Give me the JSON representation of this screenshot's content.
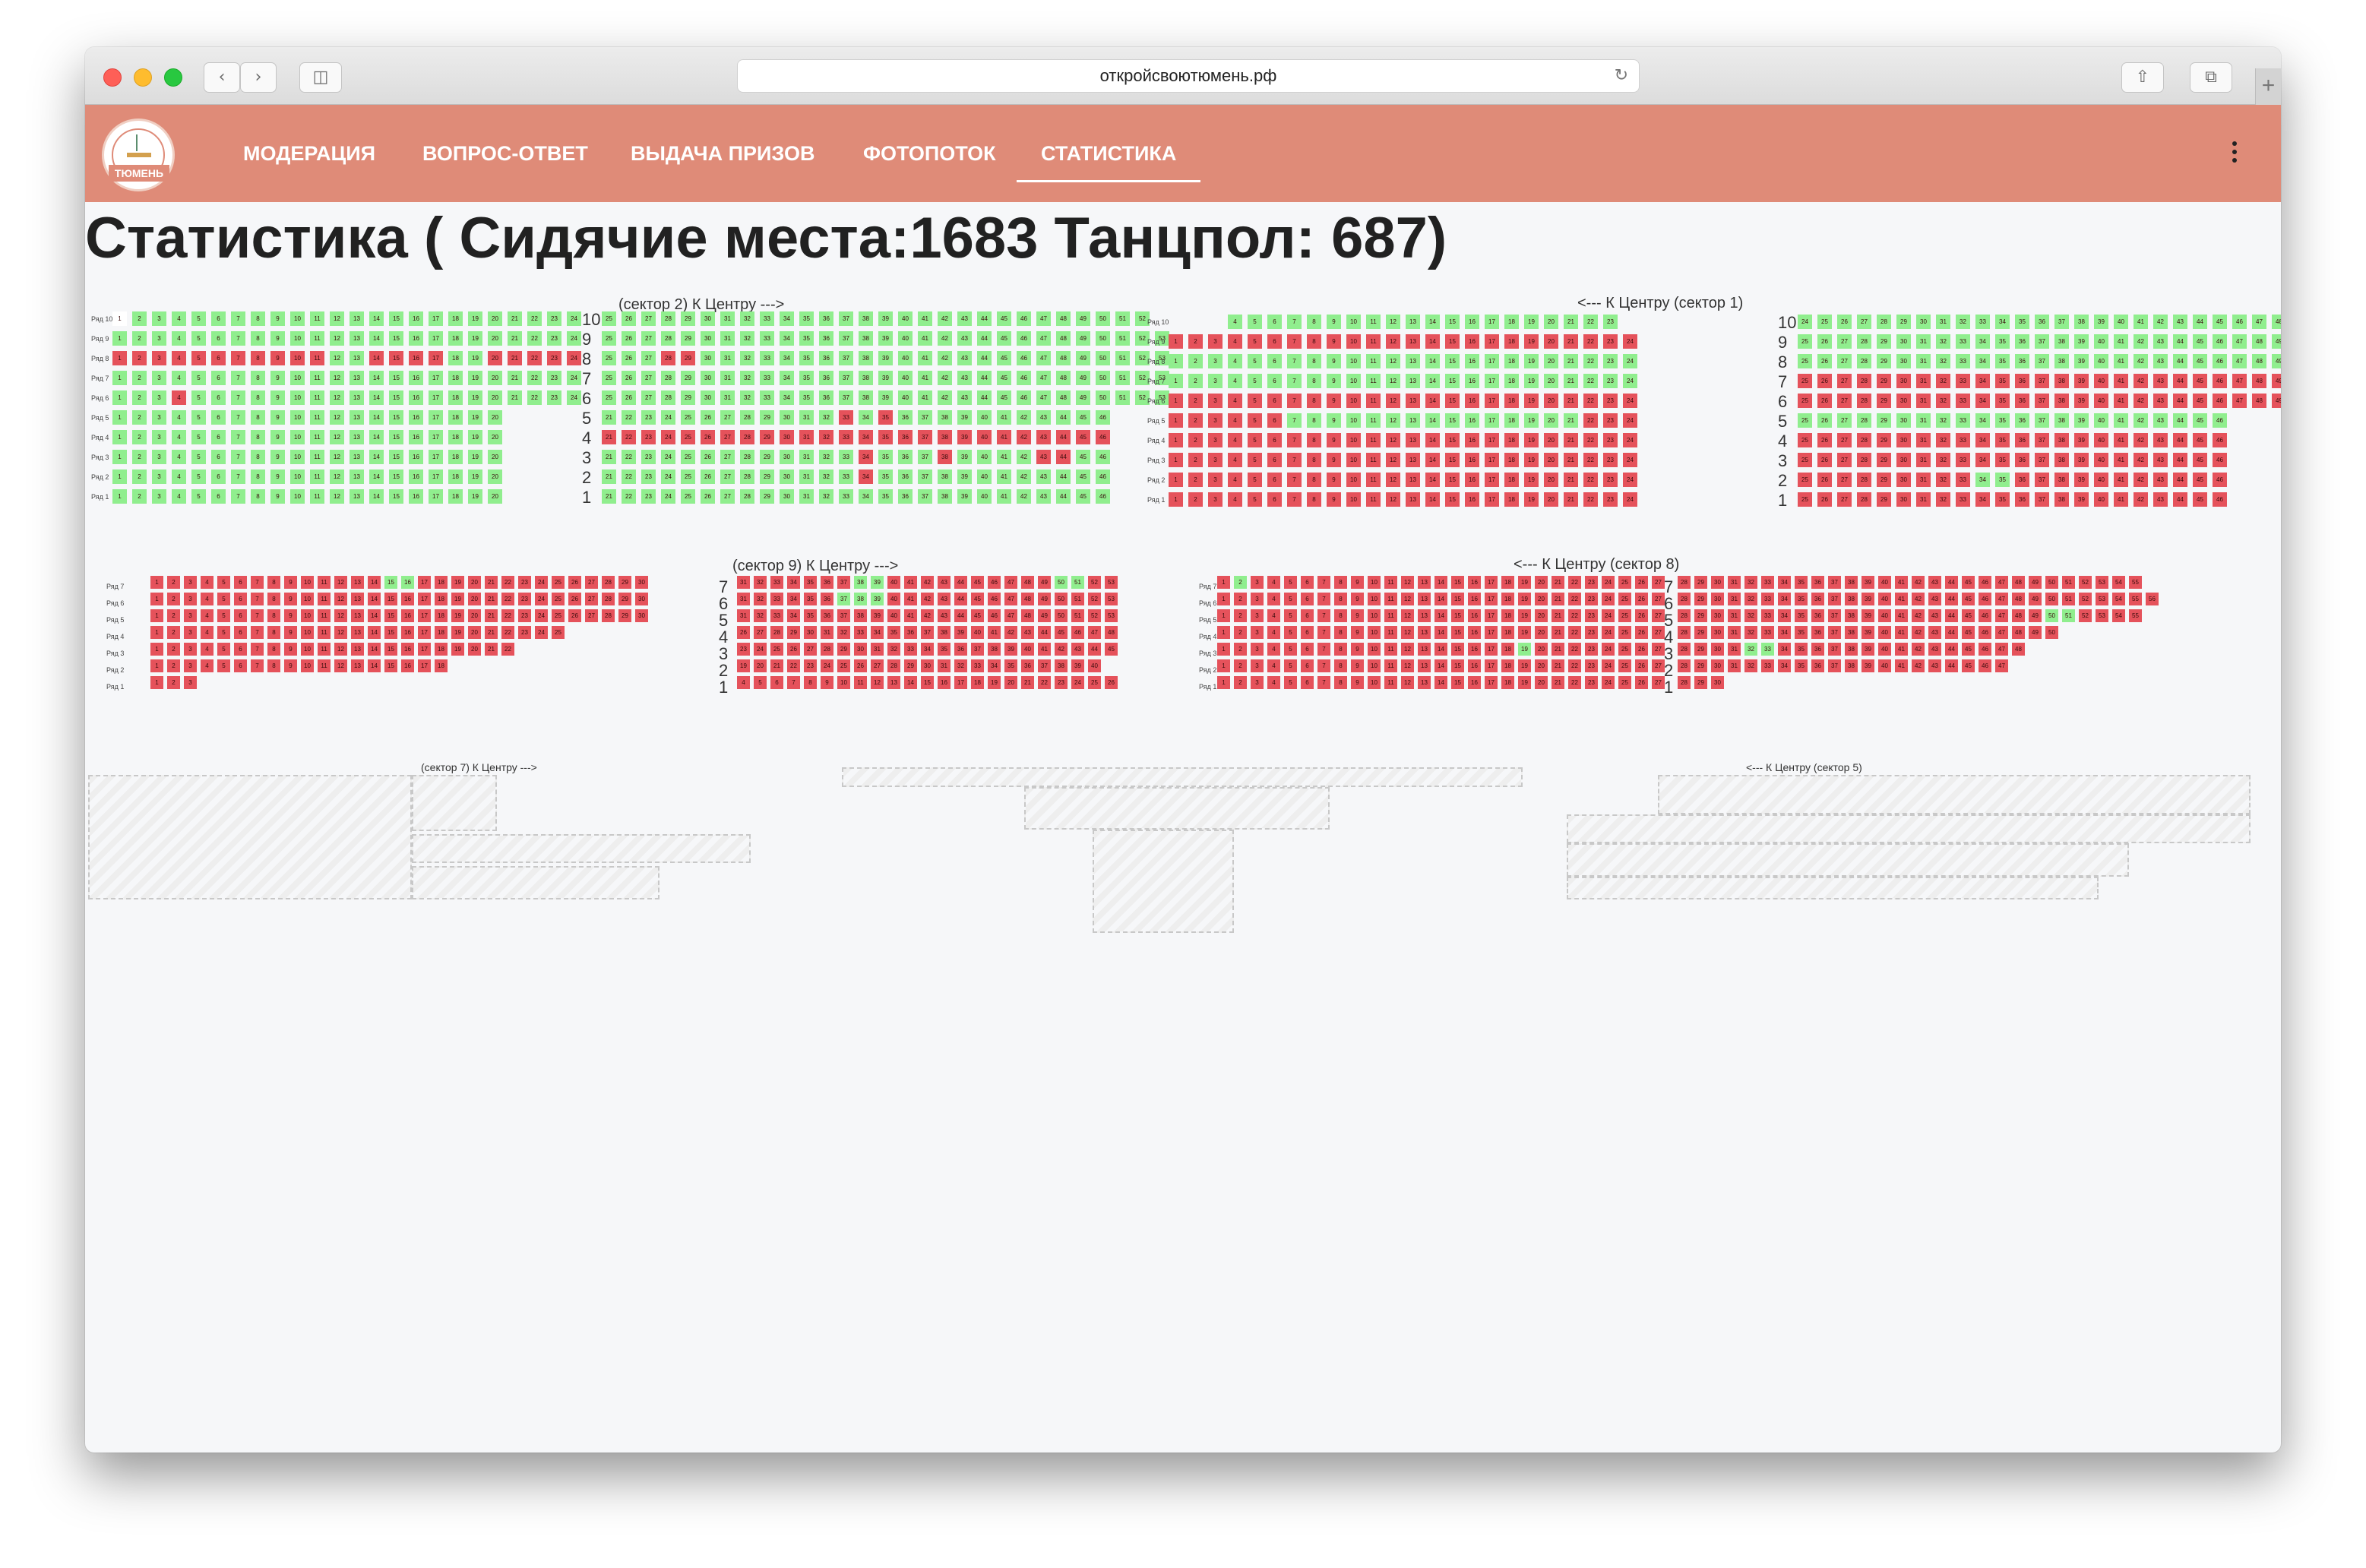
{
  "browser": {
    "url": "откройсвоютюмень.рф",
    "back_icon": "chevron-left-icon",
    "forward_icon": "chevron-right-icon",
    "sidebar_icon": "sidebar-icon",
    "reload_icon": "reload-icon",
    "share_icon": "share-icon",
    "tabs_icon": "tabs-icon",
    "new_tab_label": "+"
  },
  "header": {
    "logo_text": "ТЮМЕНЬ",
    "nav": [
      {
        "label": "МОДЕРАЦИЯ",
        "active": false
      },
      {
        "label": "ВОПРОС-ОТВЕТ",
        "active": false
      },
      {
        "label": "ВЫДАЧА ПРИЗОВ",
        "active": false
      },
      {
        "label": "ФОТОПОТОК",
        "active": false
      },
      {
        "label": "СТАТИСТИКА",
        "active": true
      }
    ],
    "menu_icon": "more-vertical-icon",
    "background": "#df8b78"
  },
  "page": {
    "title": "Статистика ( Сидячие места:1683 Танцпол: 687)"
  },
  "legend_colors": {
    "free": "#90ee8e",
    "taken": "#e5525b",
    "unmarked": "#ffffff"
  },
  "sectors": [
    {
      "id": "sector-2",
      "title": "(сектор 2) К Центру --->",
      "rows": [
        {
          "label": "Ряд 10",
          "number": 10,
          "blocks": [
            {
              "seats": "1w 2-23g 24-24g"
            },
            {
              "seats": "25-52g"
            }
          ]
        },
        {
          "label": "Ряд 9",
          "number": 9,
          "blocks": [
            {
              "seats": "1-24g"
            },
            {
              "seats": "25-53g"
            }
          ]
        },
        {
          "label": "Ряд 8",
          "number": 8,
          "blocks": [
            {
              "seats": "1-11r 12-13g 14-17r 18-19g 20-24r"
            },
            {
              "seats": "25-27g 28-29r 30-33g 34-53g"
            }
          ]
        },
        {
          "label": "Ряд 7",
          "number": 7,
          "blocks": [
            {
              "seats": "1-24g"
            },
            {
              "seats": "25-53g"
            }
          ]
        },
        {
          "label": "Ряд 6",
          "number": 6,
          "blocks": [
            {
              "seats": "1-3g 4r 5-24g"
            },
            {
              "seats": "25-53g"
            }
          ]
        },
        {
          "label": "Ряд 5",
          "number": 5,
          "blocks": [
            {
              "seats": "1-20g"
            },
            {
              "seats": "21-32g 33r 34g 35r 36-46g"
            }
          ]
        },
        {
          "label": "Ряд 4",
          "number": 4,
          "blocks": [
            {
              "seats": "1-20g"
            },
            {
              "seats": "21-46r"
            }
          ]
        },
        {
          "label": "Ряд 3",
          "number": 3,
          "blocks": [
            {
              "seats": "1-20g"
            },
            {
              "seats": "21-33g 34r 35-37g 38r 39-42g 43-44r 45-46g"
            }
          ]
        },
        {
          "label": "Ряд 2",
          "number": 2,
          "blocks": [
            {
              "seats": "1-20g"
            },
            {
              "seats": "21-33g 34r 35-46g"
            }
          ]
        },
        {
          "label": "Ряд 1",
          "number": 1,
          "blocks": [
            {
              "seats": "1-20g"
            },
            {
              "seats": "21-46g"
            }
          ]
        }
      ]
    },
    {
      "id": "sector-1",
      "title": "<--- К Центру (сектор 1)",
      "rows": [
        {
          "label": "Ряд 10",
          "number": 10,
          "blocks": [
            {
              "seats": "4-23g"
            },
            {
              "seats": "24-50g"
            }
          ]
        },
        {
          "label": "Ряд 9",
          "number": 9,
          "blocks": [
            {
              "seats": "1-24r"
            },
            {
              "seats": "25-50g"
            }
          ]
        },
        {
          "label": "Ряд 8",
          "number": 8,
          "blocks": [
            {
              "seats": "1-24g"
            },
            {
              "seats": "25-50g"
            }
          ]
        },
        {
          "label": "Ряд 7",
          "number": 7,
          "blocks": [
            {
              "seats": "1-24g"
            },
            {
              "seats": "25-50r"
            }
          ]
        },
        {
          "label": "Ряд 6",
          "number": 6,
          "blocks": [
            {
              "seats": "1-24r"
            },
            {
              "seats": "25-50r"
            }
          ]
        },
        {
          "label": "Ряд 5",
          "number": 5,
          "blocks": [
            {
              "seats": "1-6r 7-21g 22-24r"
            },
            {
              "seats": "25-46g"
            }
          ]
        },
        {
          "label": "Ряд 4",
          "number": 4,
          "blocks": [
            {
              "seats": "1-24r"
            },
            {
              "seats": "25-46r"
            }
          ]
        },
        {
          "label": "Ряд 3",
          "number": 3,
          "blocks": [
            {
              "seats": "1-24r"
            },
            {
              "seats": "25-46r"
            }
          ]
        },
        {
          "label": "Ряд 2",
          "number": 2,
          "blocks": [
            {
              "seats": "1-24r"
            },
            {
              "seats": "25-33r 34-35g 36-46r"
            }
          ]
        },
        {
          "label": "Ряд 1",
          "number": 1,
          "blocks": [
            {
              "seats": "1-24r"
            },
            {
              "seats": "25-46r"
            }
          ]
        }
      ]
    },
    {
      "id": "sector-9",
      "title": "(сектор 9) К Центру --->",
      "rows": [
        {
          "label": "Ряд 7",
          "number": 7,
          "blocks": [
            {
              "seats": "1-14r 15-16g 17-30r"
            },
            {
              "seats": "31-37r 38-39g 40-49r 50-51g 52-53r"
            }
          ]
        },
        {
          "label": "Ряд 6",
          "number": 6,
          "blocks": [
            {
              "seats": "1-30r"
            },
            {
              "seats": "31-36r 37-39g 40-53r"
            }
          ]
        },
        {
          "label": "Ряд 5",
          "number": 5,
          "blocks": [
            {
              "seats": "1-30r"
            },
            {
              "seats": "31-53r"
            }
          ]
        },
        {
          "label": "Ряд 4",
          "number": 4,
          "blocks": [
            {
              "seats": "1-25r"
            },
            {
              "seats": "26-48r"
            }
          ]
        },
        {
          "label": "Ряд 3",
          "number": 3,
          "blocks": [
            {
              "seats": "1-22r"
            },
            {
              "seats": "23-45r"
            }
          ]
        },
        {
          "label": "Ряд 2",
          "number": 2,
          "blocks": [
            {
              "seats": "1-18r"
            },
            {
              "seats": "19-40r"
            }
          ]
        },
        {
          "label": "Ряд 1",
          "number": 1,
          "blocks": [
            {
              "seats": "1-3r"
            },
            {
              "seats": "4-26r"
            }
          ]
        }
      ]
    },
    {
      "id": "sector-8",
      "title": "<--- К Центру (сектор 8)",
      "rows": [
        {
          "label": "Ряд 7",
          "number": 7,
          "blocks": [
            {
              "seats": "1r 2g 3-27r"
            },
            {
              "seats": "28-55r"
            }
          ]
        },
        {
          "label": "Ряд 6",
          "number": 6,
          "blocks": [
            {
              "seats": "1-27r"
            },
            {
              "seats": "28-56r"
            }
          ]
        },
        {
          "label": "Ряд 5",
          "number": 5,
          "blocks": [
            {
              "seats": "1-27r"
            },
            {
              "seats": "28-49r 50-51g 52-55r"
            }
          ]
        },
        {
          "label": "Ряд 4",
          "number": 4,
          "blocks": [
            {
              "seats": "1-27r"
            },
            {
              "seats": "28-50r"
            }
          ]
        },
        {
          "label": "Ряд 3",
          "number": 3,
          "blocks": [
            {
              "seats": "1-18r 19g 20-27r"
            },
            {
              "seats": "28-31r 32-33g 34-48r"
            }
          ]
        },
        {
          "label": "Ряд 2",
          "number": 2,
          "blocks": [
            {
              "seats": "1-27r"
            },
            {
              "seats": "28-47r"
            }
          ]
        },
        {
          "label": "Ряд 1",
          "number": 1,
          "blocks": [
            {
              "seats": "1-27r"
            },
            {
              "seats": "28-30r"
            }
          ]
        }
      ]
    },
    {
      "id": "sector-7",
      "title": "(сектор 7) К Центру --->",
      "rows": []
    },
    {
      "id": "sector-6",
      "title": "",
      "rows": []
    },
    {
      "id": "sector-5",
      "title": "<--- К Центру (сектор 5)",
      "rows": []
    }
  ]
}
